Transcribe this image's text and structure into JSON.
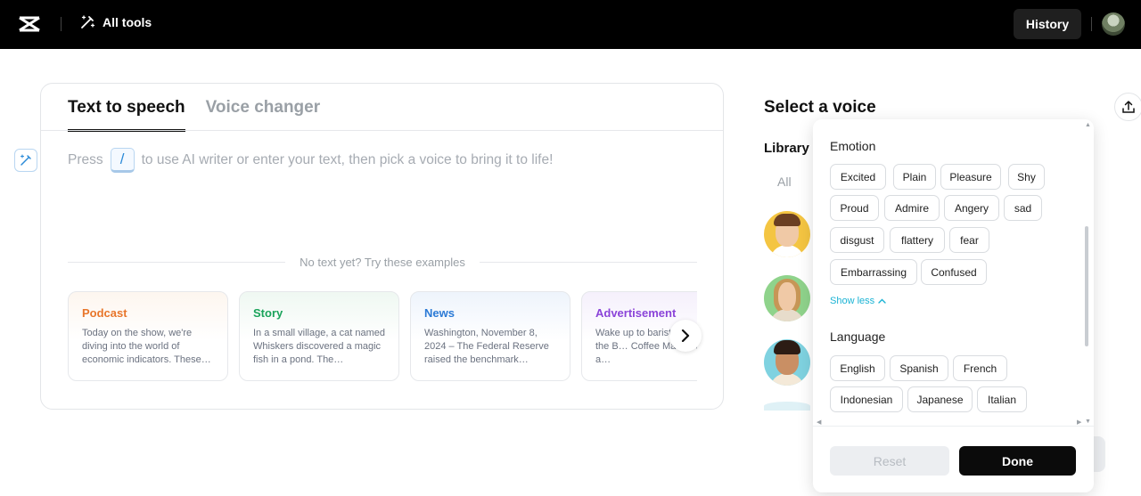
{
  "topbar": {
    "logo_icon": "capcut-logo-icon",
    "all_tools_label": "All tools",
    "history_label": "History"
  },
  "editor": {
    "tabs": [
      {
        "label": "Text to speech",
        "active": true
      },
      {
        "label": "Voice changer",
        "active": false
      }
    ],
    "placeholder_before": "Press",
    "placeholder_key": "/",
    "placeholder_after": "to use AI writer or enter your text, then pick a voice to bring it to life!",
    "examples_label": "No text yet? Try these examples",
    "examples": [
      {
        "title": "Podcast",
        "text": "Today on the show, we're diving into the world of economic indicators. These…",
        "color": "#e8762b"
      },
      {
        "title": "Story",
        "text": "In a small village, a cat named Whiskers discovered a magic fish in a pond. The…",
        "color": "#1aa35a"
      },
      {
        "title": "News",
        "text": "Washington, November 8, 2024 – The Federal Reserve raised the benchmark…",
        "color": "#2b7ad6"
      },
      {
        "title": "Advertisement",
        "text": "Wake up to barista coffee with the B… Coffee Maker! With a…",
        "color": "#8b44d9"
      }
    ]
  },
  "voice_panel": {
    "title": "Select a voice",
    "library_label": "Library (",
    "filter_all": "All"
  },
  "filter_popup": {
    "emotion_title": "Emotion",
    "emotions": [
      "Excited",
      "Plain",
      "Pleasure",
      "Shy",
      "Proud",
      "Admire",
      "Angery",
      "sad",
      "disgust",
      "flattery",
      "fear",
      "Embarrassing",
      "Confused"
    ],
    "show_less": "Show less",
    "language_title": "Language",
    "languages": [
      "English",
      "Spanish",
      "French",
      "Indonesian",
      "Japanese",
      "Italian"
    ],
    "reset_label": "Reset",
    "done_label": "Done"
  }
}
